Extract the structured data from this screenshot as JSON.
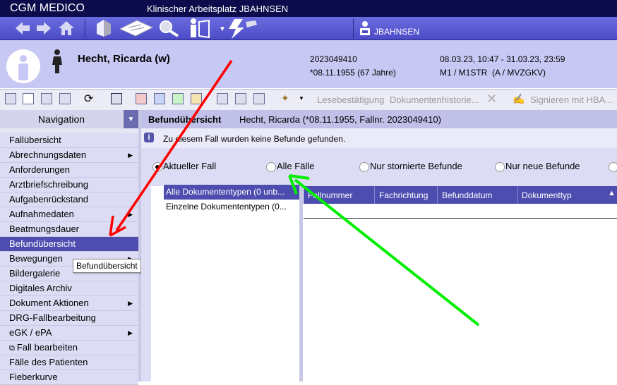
{
  "app": {
    "name": "CGM MEDICO",
    "window_title": "Klinischer Arbeitsplatz JBAHNSEN"
  },
  "toolbar": {
    "icons": [
      "back-arrow-icon",
      "forward-arrow-icon",
      "home-icon",
      "building-icon",
      "document-icon",
      "search-icon",
      "person-door-icon",
      "signature-icon"
    ],
    "user": "JBAHNSEN"
  },
  "patient": {
    "name": "Hecht, Ricarda (w)",
    "case_number": "2023049410",
    "birth": "*08.11.1955 (67 Jahre)",
    "stay": "08.03.23, 10:47 - 31.03.23, 23:59",
    "ward": "M1 / M1STR  (A / MVZGKV)"
  },
  "toolbar2": {
    "lesebestaetigung": "Lesebestätigung",
    "dokumentenhistorie": "Dokumentenhistorie...",
    "signieren": "Signieren mit HBA..."
  },
  "navigation": {
    "title": "Navigation",
    "items": [
      {
        "label": "Fallübersicht",
        "arrow": false
      },
      {
        "label": "Abrechnungsdaten",
        "arrow": true
      },
      {
        "label": "Anforderungen",
        "arrow": false
      },
      {
        "label": "Arztbriefschreibung",
        "arrow": false
      },
      {
        "label": "Aufgabenrückstand",
        "arrow": false
      },
      {
        "label": "Aufnahmedaten",
        "arrow": true
      },
      {
        "label": "Beatmungsdauer",
        "arrow": false
      },
      {
        "label": "Befundübersicht",
        "arrow": false,
        "selected": true
      },
      {
        "label": "Bewegungen",
        "arrow": true
      },
      {
        "label": "Bildergalerie",
        "arrow": false
      },
      {
        "label": "Digitales Archiv",
        "arrow": false
      },
      {
        "label": "Dokument Aktionen",
        "arrow": true
      },
      {
        "label": "DRG-Fallbearbeitung",
        "arrow": false
      },
      {
        "label": "eGK / ePA",
        "arrow": true
      },
      {
        "label": "Fall bearbeiten",
        "arrow": false
      },
      {
        "label": "Fälle des Patienten",
        "arrow": false
      },
      {
        "label": "Fieberkurve",
        "arrow": false
      }
    ],
    "tooltip": "Befundübersicht"
  },
  "content": {
    "title": "Befundübersicht",
    "patient": "Hecht, Ricarda (*08.11.1955, Fallnr. 2023049410)",
    "info": "Zu diesem Fall wurden keine Befunde gefunden.",
    "radios": [
      {
        "label": "Aktueller Fall",
        "checked": true
      },
      {
        "label": "Alle Fälle",
        "checked": false
      },
      {
        "label": "Nur stornierte Befunde",
        "checked": false
      },
      {
        "label": "Nur neue Befunde",
        "checked": false
      }
    ],
    "doctypes": [
      {
        "label": "Alle Dokumententypen (0 unb...",
        "selected": true
      },
      {
        "label": "Einzelne Dokumententypen (0...",
        "selected": false
      }
    ],
    "columns": [
      "Fallnummer",
      "Fachrichtung",
      "Befunddatum",
      "Dokumenttyp"
    ]
  },
  "annotations": {
    "red_arrow_color": "#ff0000",
    "green_arrow_color": "#00ee00"
  }
}
